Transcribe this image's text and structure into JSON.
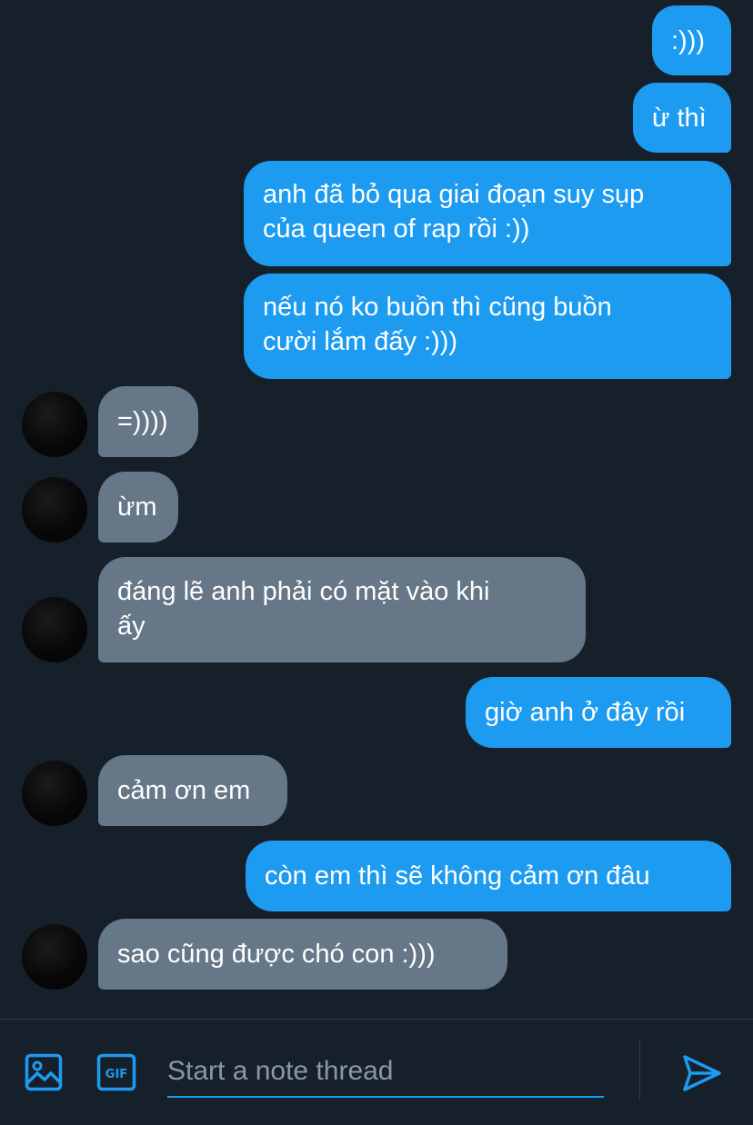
{
  "conversation": {
    "messages": [
      {
        "direction": "out",
        "text": ":)))"
      },
      {
        "direction": "out",
        "text": "ừ thì"
      },
      {
        "direction": "out",
        "lines": [
          "anh đã bỏ qua giai đoạn suy sụp",
          "của queen of rap rồi :))"
        ]
      },
      {
        "direction": "out",
        "lines": [
          "nếu nó ko buồn thì cũng buồn",
          "cười lắm đấy :)))"
        ]
      },
      {
        "direction": "in",
        "text": "=))))"
      },
      {
        "direction": "in",
        "text": "ừm"
      },
      {
        "direction": "in",
        "lines": [
          "đáng lẽ anh phải có mặt vào khi",
          "ấy"
        ]
      },
      {
        "direction": "out",
        "text": "giờ anh ở đây rồi"
      },
      {
        "direction": "in",
        "text": "cảm ơn em"
      },
      {
        "direction": "out",
        "text": "còn em thì sẽ không cảm ơn đâu"
      },
      {
        "direction": "in",
        "text": "sao cũng được chó con :)))"
      }
    ]
  },
  "composer": {
    "placeholder": "Start a note thread",
    "media_icon": "image-icon",
    "gif_icon": "gif-icon",
    "gif_label": "GIF",
    "send_icon": "send-icon"
  },
  "colors": {
    "background": "#16202b",
    "outgoing_bubble": "#1d9bf0",
    "incoming_bubble": "#667787",
    "accent": "#1d9bf0",
    "placeholder_text": "#8b98a5"
  }
}
